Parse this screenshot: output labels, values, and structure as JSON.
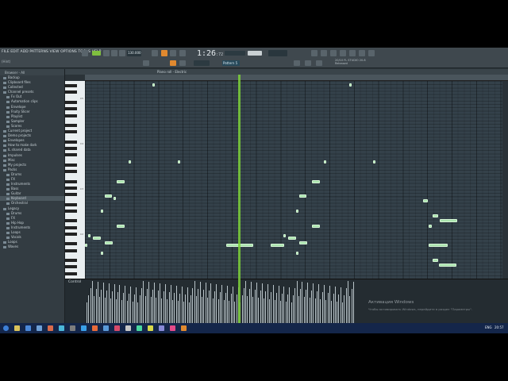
{
  "app": {
    "menu_text": "FILE EDIT ADD PATTERNS VIEW OPTIONS TOOLS HELP",
    "hint_text": "(Hint)",
    "time_main": "1:26",
    "time_sub": ":72",
    "tempo": "130.000",
    "pattern": "Pattern 5",
    "info_line1": "20/10  FL STUDIO 20.8",
    "info_line2": "Released"
  },
  "browser": {
    "header": "Browser - All",
    "items": [
      {
        "label": "Backup",
        "sub": false
      },
      {
        "label": "Clipboard files",
        "sub": false
      },
      {
        "label": "Collected",
        "sub": false
      },
      {
        "label": "Channel presets",
        "sub": false
      },
      {
        "label": "Fx Out",
        "sub": true
      },
      {
        "label": "Automation clips",
        "sub": true
      },
      {
        "label": "Envelope",
        "sub": true
      },
      {
        "label": "Fruity Slicer",
        "sub": true
      },
      {
        "label": "Playlist",
        "sub": true
      },
      {
        "label": "Sampler",
        "sub": true
      },
      {
        "label": "Scores",
        "sub": true
      },
      {
        "label": "Current project",
        "sub": false
      },
      {
        "label": "Demo projects",
        "sub": false
      },
      {
        "label": "Envelopes",
        "sub": false
      },
      {
        "label": "How to make dark",
        "sub": false
      },
      {
        "label": "IL shared data",
        "sub": false
      },
      {
        "label": "Impulses",
        "sub": false
      },
      {
        "label": "Misc",
        "sub": false
      },
      {
        "label": "My projects",
        "sub": false
      },
      {
        "label": "Packs",
        "sub": false
      },
      {
        "label": "Drums",
        "sub": true
      },
      {
        "label": "FX",
        "sub": true
      },
      {
        "label": "Instruments",
        "sub": true
      },
      {
        "label": "Bass",
        "sub": true
      },
      {
        "label": "Guitar",
        "sub": true
      },
      {
        "label": "Keyboard",
        "sub": true,
        "selected": true
      },
      {
        "label": "Orchestral",
        "sub": true
      },
      {
        "label": "Legacy",
        "sub": false
      },
      {
        "label": "Drums",
        "sub": true
      },
      {
        "label": "FX",
        "sub": true
      },
      {
        "label": "Hip Hop",
        "sub": true
      },
      {
        "label": "Instruments",
        "sub": true
      },
      {
        "label": "Loops",
        "sub": true
      },
      {
        "label": "Vocals",
        "sub": true
      },
      {
        "label": "Loops",
        "sub": false
      },
      {
        "label": "Waves",
        "sub": false
      }
    ]
  },
  "piano_roll": {
    "title": "Piano roll - Electric",
    "key_labels": [
      "C5",
      "C4",
      "C3",
      "C2"
    ],
    "notes": [
      {
        "row": 1,
        "start": 85,
        "len": 2
      },
      {
        "row": 1,
        "start": 333,
        "len": 2
      },
      {
        "row": 32,
        "start": 55,
        "len": 2
      },
      {
        "row": 32,
        "start": 117,
        "len": 2
      },
      {
        "row": 32,
        "start": 301,
        "len": 2
      },
      {
        "row": 32,
        "start": 363,
        "len": 2
      },
      {
        "row": 40,
        "start": 40,
        "len": 10
      },
      {
        "row": 40,
        "start": 286,
        "len": 10
      },
      {
        "row": 46,
        "start": 25,
        "len": 9
      },
      {
        "row": 46,
        "start": 270,
        "len": 9
      },
      {
        "row": 47,
        "start": 36,
        "len": 2
      },
      {
        "row": 48,
        "start": 426,
        "len": 6
      },
      {
        "row": 52,
        "start": 20,
        "len": 2
      },
      {
        "row": 52,
        "start": 266,
        "len": 2
      },
      {
        "row": 54,
        "start": 438,
        "len": 7
      },
      {
        "row": 56,
        "start": 447,
        "len": 22
      },
      {
        "row": 58,
        "start": 40,
        "len": 10
      },
      {
        "row": 58,
        "start": 286,
        "len": 10
      },
      {
        "row": 58,
        "start": 433,
        "len": 4
      },
      {
        "row": 62,
        "start": 4,
        "len": 2
      },
      {
        "row": 62,
        "start": 250,
        "len": 2
      },
      {
        "row": 63,
        "start": 10,
        "len": 10
      },
      {
        "row": 63,
        "start": 256,
        "len": 10
      },
      {
        "row": 65,
        "start": 25,
        "len": 10
      },
      {
        "row": 65,
        "start": 270,
        "len": 10
      },
      {
        "row": 66,
        "start": 0,
        "len": 3
      },
      {
        "row": 66,
        "start": 178,
        "len": 34
      },
      {
        "row": 66,
        "start": 234,
        "len": 17
      },
      {
        "row": 66,
        "start": 433,
        "len": 24
      },
      {
        "row": 69,
        "start": 20,
        "len": 2
      },
      {
        "row": 69,
        "start": 266,
        "len": 2
      },
      {
        "row": 72,
        "start": 438,
        "len": 7
      },
      {
        "row": 74,
        "start": 446,
        "len": 22
      }
    ],
    "control_label": "Control"
  },
  "watermark": {
    "line1": "Активация Windows",
    "line2": "Чтобы активировать Windows, перейдите в раздел \"Параметры\"."
  },
  "taskbar": {
    "lang": "ENG",
    "clock": "20:57"
  },
  "colors": {
    "note_fill": "#a9e3ad",
    "playhead": "#7dd03a",
    "accent": "#e0892f"
  }
}
